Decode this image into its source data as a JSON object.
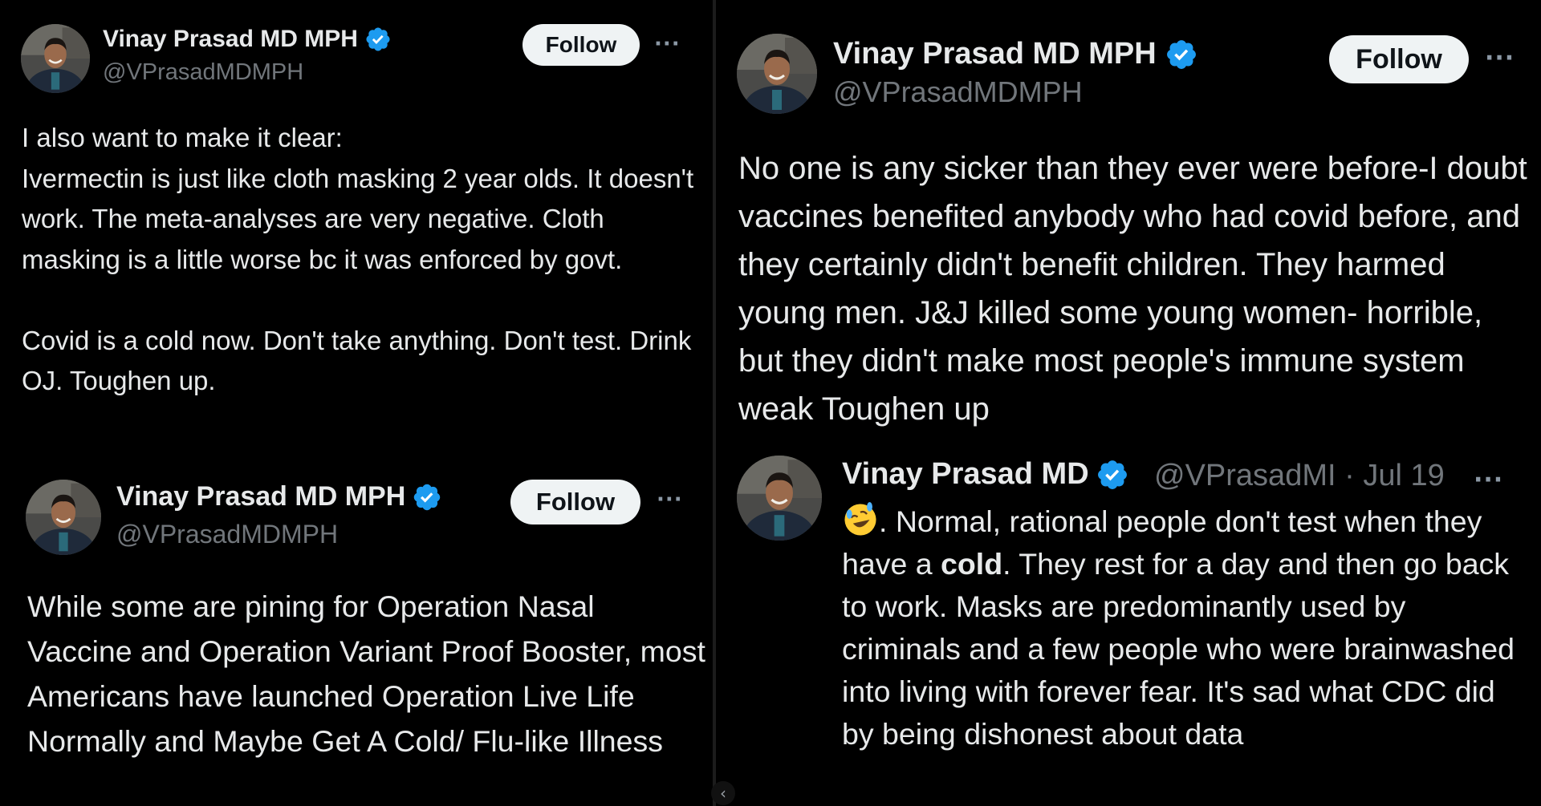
{
  "colors": {
    "background": "#000000",
    "text": "#e7e9ea",
    "secondary_text": "#71767b",
    "verified_badge": "#1d9bf0",
    "follow_button_bg": "#eff3f4",
    "follow_button_text": "#0f1419"
  },
  "tweet_top_left": {
    "author_name": "Vinay Prasad MD MPH",
    "handle": "@VPrasadMDMPH",
    "verified_icon": "verified-badge-icon",
    "follow_label": "Follow",
    "more_label": "···",
    "text": "I also want to make it clear:\nIvermectin is just like cloth masking 2 year olds. It doesn't work. The meta-analyses are very negative.  Cloth masking is a little worse bc it was enforced by govt.\n\nCovid is a cold now. Don't take anything. Don't test.  Drink OJ. Toughen up."
  },
  "tweet_bottom_left": {
    "author_name": "Vinay Prasad MD MPH",
    "handle": "@VPrasadMDMPH",
    "verified_icon": "verified-badge-icon",
    "follow_label": "Follow",
    "more_label": "···",
    "text": "While some are pining for Operation Nasal Vaccine and Operation Variant Proof Booster, most Americans have launched Operation Live Life Normally and Maybe Get A Cold/ Flu-like Illness"
  },
  "tweet_right": {
    "author_name": "Vinay Prasad MD MPH",
    "handle": "@VPrasadMDMPH",
    "verified_icon": "verified-badge-icon",
    "follow_label": "Follow",
    "more_label": "···",
    "text": "No one is any sicker than they ever were before-I doubt vaccines benefited anybody who had covid before, and they certainly didn't benefit children. They harmed young men. J&J killed some young women- horrible, but they didn't make most people's immune system weak Toughen up"
  },
  "tweet_right_reply": {
    "author_name": "Vinay Prasad MD",
    "handle": "@VPrasadMI",
    "separator": "·",
    "date": "Jul 19",
    "verified_icon": "verified-badge-icon",
    "more_label": "···",
    "emoji": "rolling-on-floor-laughing-emoji",
    "text_before_bold": ". Normal, rational people don't test when they have a ",
    "bold_word": "cold",
    "text_after_bold": ". They rest for a day and then go back to work.  Masks are predominantly used by criminals and a few people who were brainwashed into living with forever fear.  It's sad what CDC did by being dishonest about data"
  },
  "navigation": {
    "back_label": "‹"
  }
}
